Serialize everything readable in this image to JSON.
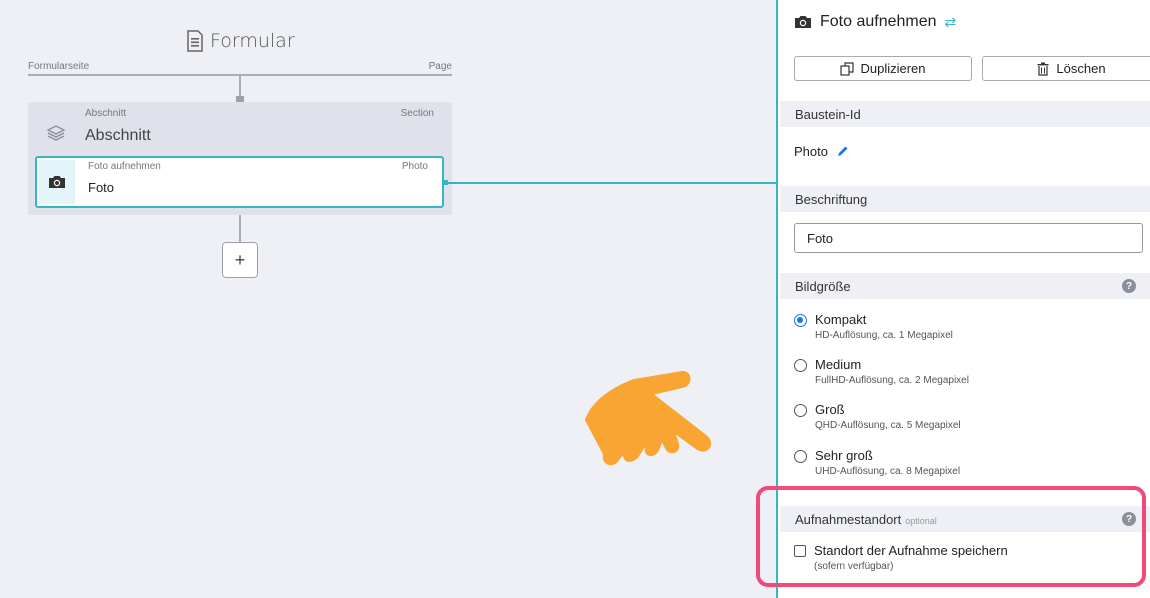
{
  "canvas": {
    "form_title": "Formular",
    "page_label_left": "Formularseite",
    "page_label_right": "Page",
    "section": {
      "meta_left": "Abschnitt",
      "meta_right": "Section",
      "title": "Abschnitt"
    },
    "photo": {
      "meta_left": "Foto aufnehmen",
      "meta_right": "Photo",
      "title": "Foto"
    },
    "add_label": "+"
  },
  "panel": {
    "title": "Foto aufnehmen",
    "swap_icon": "⇄",
    "duplicate_label": "Duplizieren",
    "delete_label": "Löschen",
    "id_heading": "Baustein-Id",
    "id_value": "Photo",
    "caption_heading": "Beschriftung",
    "caption_value": "Foto",
    "size_heading": "Bildgröße",
    "help_glyph": "?",
    "size_options": [
      {
        "label": "Kompakt",
        "desc": "HD-Auflösung, ca. 1 Megapixel",
        "checked": true
      },
      {
        "label": "Medium",
        "desc": "FullHD-Auflösung, ca. 2 Megapixel",
        "checked": false
      },
      {
        "label": "Groß",
        "desc": "QHD-Auflösung, ca. 5 Megapixel",
        "checked": false
      },
      {
        "label": "Sehr groß",
        "desc": "UHD-Auflösung, ca. 8 Megapixel",
        "checked": false
      }
    ],
    "location_heading": "Aufnahmestandort",
    "location_optional": "optional",
    "location_checkbox_label": "Standort der Aufnahme speichern",
    "location_checkbox_desc": "(sofern verfügbar)",
    "location_checked": false
  },
  "colors": {
    "accent": "#35b6c7",
    "highlight": "#ef4a78",
    "pointer": "#f9a533",
    "radio": "#1a73e8"
  }
}
